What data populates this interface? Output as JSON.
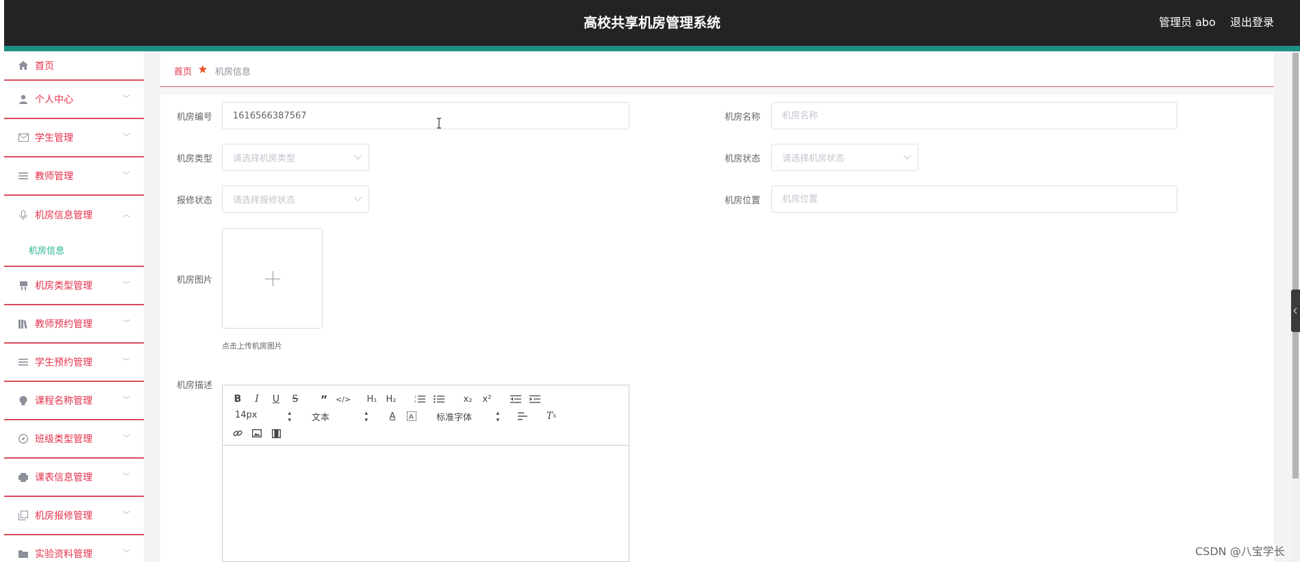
{
  "header": {
    "title": "高校共享机房管理系统",
    "user_label": "管理员 abo",
    "logout": "退出登录"
  },
  "sidebar": {
    "items": [
      {
        "label": "首页",
        "icon": "home-icon"
      },
      {
        "label": "个人中心",
        "icon": "user-icon"
      },
      {
        "label": "学生管理",
        "icon": "mail-icon"
      },
      {
        "label": "教师管理",
        "icon": "list-icon"
      },
      {
        "label": "机房信息管理",
        "icon": "microphone-icon",
        "expanded": true
      },
      {
        "label": "机房类型管理",
        "icon": "chair-icon"
      },
      {
        "label": "教师预约管理",
        "icon": "books-icon"
      },
      {
        "label": "学生预约管理",
        "icon": "list-icon"
      },
      {
        "label": "课程名称管理",
        "icon": "bulb-icon"
      },
      {
        "label": "班级类型管理",
        "icon": "compass-icon"
      },
      {
        "label": "课表信息管理",
        "icon": "printer-icon"
      },
      {
        "label": "机房报修管理",
        "icon": "copy-icon"
      },
      {
        "label": "实验资料管理",
        "icon": "folder-icon"
      }
    ],
    "submenu": {
      "label": "机房信息"
    }
  },
  "breadcrumb": {
    "home": "首页",
    "current": "机房信息"
  },
  "form": {
    "room_no": {
      "label": "机房编号",
      "value": "1616566387567"
    },
    "room_name": {
      "label": "机房名称",
      "placeholder": "机房名称"
    },
    "room_type": {
      "label": "机房类型",
      "placeholder": "请选择机房类型"
    },
    "room_status": {
      "label": "机房状态",
      "placeholder": "请选择机房状态"
    },
    "repair_status": {
      "label": "报修状态",
      "placeholder": "请选择报修状态"
    },
    "room_location": {
      "label": "机房位置",
      "placeholder": "机房位置"
    },
    "room_image": {
      "label": "机房图片",
      "tip": "点击上传机房图片"
    },
    "room_desc": {
      "label": "机房描述"
    }
  },
  "editor": {
    "font_size": "14px",
    "header_picker": "文本",
    "font_family": "标准字体"
  },
  "watermark": "CSDN @八宝学长",
  "colors": {
    "accent": "#e5304b",
    "teal": "#1f8f85",
    "active_sub": "#21b28e",
    "header_bg": "#232323"
  }
}
